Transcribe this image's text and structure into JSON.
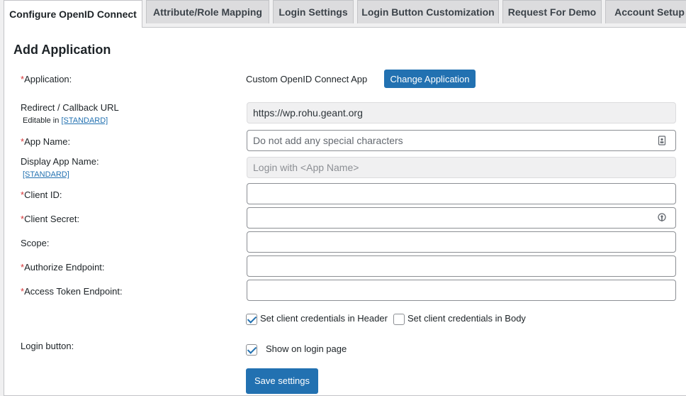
{
  "tabs": [
    {
      "label": "Configure OpenID Connect",
      "active": true
    },
    {
      "label": "Attribute/Role Mapping"
    },
    {
      "label": "Login Settings"
    },
    {
      "label": "Login Button Customization"
    },
    {
      "label": "Request For Demo"
    },
    {
      "label": "Account Setup"
    }
  ],
  "section": {
    "title": "Add Application"
  },
  "required_marker": "*",
  "application": {
    "label": "Application:",
    "value": "Custom OpenID Connect App",
    "change_button": "Change Application"
  },
  "redirect": {
    "label": "Redirect / Callback URL",
    "editable_prefix": "Editable in",
    "editable_link": "[STANDARD]",
    "value": "https://wp.rohu.geant.org"
  },
  "app_name": {
    "label": "App Name:",
    "placeholder": "Do not add any special characters",
    "icon": "contact-card-icon"
  },
  "display_app_name": {
    "label": "Display App Name:",
    "link": "[STANDARD]",
    "placeholder": "Login with <App Name>"
  },
  "client_id": {
    "label": "Client ID:",
    "value": ""
  },
  "client_secret": {
    "label": "Client Secret:",
    "value": "",
    "icon": "key-icon"
  },
  "scope": {
    "label": "Scope:",
    "value": ""
  },
  "authorize_endpoint": {
    "label": "Authorize Endpoint:",
    "value": ""
  },
  "access_token_endpoint": {
    "label": "Access Token Endpoint:",
    "value": ""
  },
  "credentials": {
    "header_label": "Set client credentials in Header",
    "header_checked": true,
    "body_label": "Set client credentials in Body",
    "body_checked": false
  },
  "login_button": {
    "label": "Login button:",
    "show_label": "Show on login page",
    "show_checked": true
  },
  "save_button": "Save settings",
  "colors": {
    "primary": "#2271b1",
    "required": "#d63638",
    "tab_bg": "#dcdcde"
  }
}
